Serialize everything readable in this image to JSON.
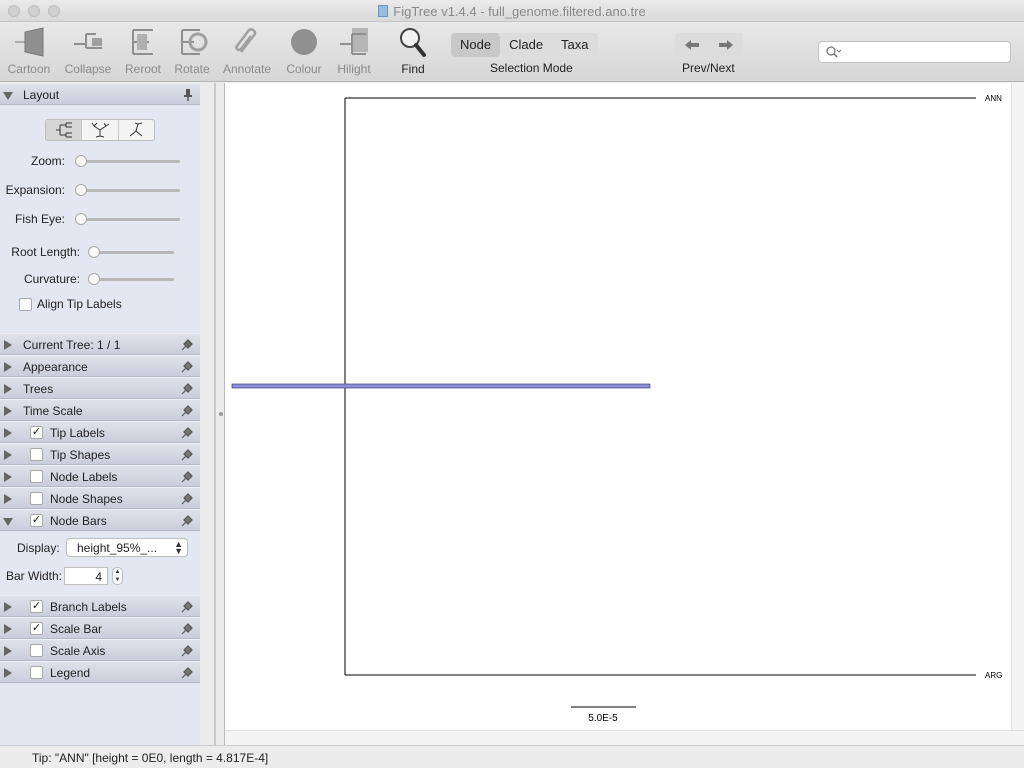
{
  "window": {
    "title": "FigTree v1.4.4 - full_genome.filtered.ano.tre"
  },
  "toolbar": {
    "buttons": [
      {
        "label": "Cartoon",
        "icon": "cartoon-icon"
      },
      {
        "label": "Collapse",
        "icon": "collapse-icon"
      },
      {
        "label": "Reroot",
        "icon": "reroot-icon"
      },
      {
        "label": "Rotate",
        "icon": "rotate-icon"
      },
      {
        "label": "Annotate",
        "icon": "paperclip-icon"
      },
      {
        "label": "Colour",
        "icon": "colour-icon"
      },
      {
        "label": "Hilight",
        "icon": "hilight-icon"
      },
      {
        "label": "Find",
        "icon": "magnifier-icon"
      }
    ],
    "selection_mode": {
      "label": "Selection Mode",
      "options": [
        "Node",
        "Clade",
        "Taxa"
      ],
      "selected": "Node"
    },
    "prev_next_label": "Prev/Next",
    "search": {
      "value": "",
      "placeholder": ""
    }
  },
  "sidebar": {
    "layout": {
      "title": "Layout",
      "expanded": true,
      "sliders": [
        {
          "label": "Zoom:",
          "value": 0
        },
        {
          "label": "Expansion:",
          "value": 0
        },
        {
          "label": "Fish Eye:",
          "value": 0
        },
        {
          "label": "Root Length:",
          "value": 0
        },
        {
          "label": "Curvature:",
          "value": 0
        }
      ],
      "align_tip_labels": {
        "label": "Align Tip Labels",
        "checked": false
      }
    },
    "sections": [
      {
        "label": "Current Tree: 1 / 1",
        "checkbox": null
      },
      {
        "label": "Appearance",
        "checkbox": null
      },
      {
        "label": "Trees",
        "checkbox": null
      },
      {
        "label": "Time Scale",
        "checkbox": null
      },
      {
        "label": "Tip Labels",
        "checkbox": true
      },
      {
        "label": "Tip Shapes",
        "checkbox": false
      },
      {
        "label": "Node Labels",
        "checkbox": false
      },
      {
        "label": "Node Shapes",
        "checkbox": false
      },
      {
        "label": "Node Bars",
        "checkbox": true,
        "expanded": true
      }
    ],
    "node_bars": {
      "display_label": "Display:",
      "display_value": "height_95%_...",
      "bar_width_label": "Bar Width:",
      "bar_width_value": "4"
    },
    "sections_after": [
      {
        "label": "Branch Labels",
        "checkbox": true
      },
      {
        "label": "Scale Bar",
        "checkbox": true
      },
      {
        "label": "Scale Axis",
        "checkbox": false
      },
      {
        "label": "Legend",
        "checkbox": false
      }
    ]
  },
  "tree": {
    "tips": [
      "ANN",
      "ARG"
    ],
    "scale_bar_label": "5.0E-5",
    "node_bar_color": "#8c91d4"
  },
  "status": {
    "text": "Tip: \"ANN\" [height = 0E0, length = 4.817E-4]"
  }
}
